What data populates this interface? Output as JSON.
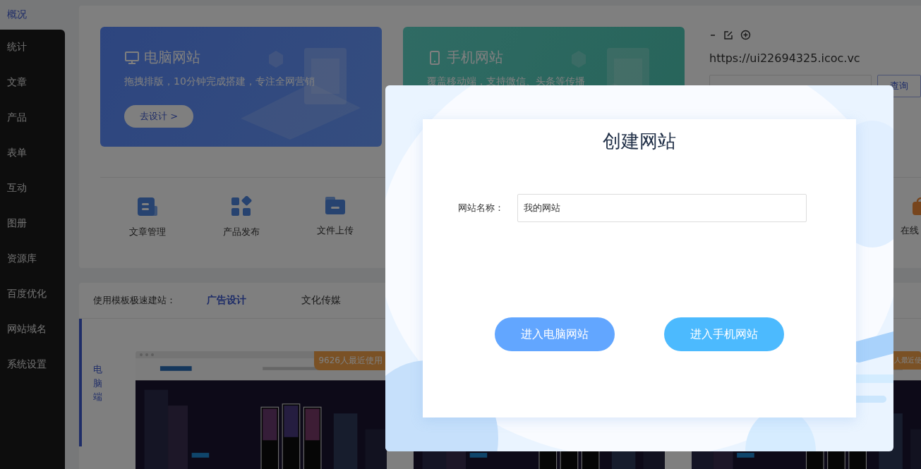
{
  "sidebar": {
    "items": [
      {
        "label": "概况",
        "selected": true
      },
      {
        "label": "统计",
        "selected": false
      },
      {
        "label": "文章",
        "selected": false
      },
      {
        "label": "产品",
        "selected": false
      },
      {
        "label": "表单",
        "selected": false
      },
      {
        "label": "互动",
        "selected": false
      },
      {
        "label": "图册",
        "selected": false
      },
      {
        "label": "资源库",
        "selected": false
      },
      {
        "label": "百度优化",
        "selected": false
      },
      {
        "label": "网站域名",
        "selected": false
      },
      {
        "label": "系统设置",
        "selected": false
      }
    ]
  },
  "site_cards": [
    {
      "kind": "desktop",
      "title": "电脑网站",
      "subtitle": "拖拽排版，10分钟完成搭建，专注全网营销",
      "button": "去设计 >"
    },
    {
      "kind": "mobile",
      "title": "手机网站",
      "subtitle": "覆盖移动端，支持微信、头条等传播"
    }
  ],
  "site_info": {
    "url": "https://ui22694325.icoc.vc",
    "query_button": "查询"
  },
  "quick_actions": [
    {
      "kind": "article",
      "label": "文章管理"
    },
    {
      "kind": "product",
      "label": "产品发布"
    },
    {
      "kind": "file",
      "label": "文件上传"
    },
    {
      "kind": "online",
      "label": "在线"
    }
  ],
  "templates": {
    "label": "使用模板极速建站：",
    "tabs": [
      {
        "label": "广告设计",
        "selected": true
      },
      {
        "label": "文化传媒",
        "selected": false
      }
    ],
    "category": "电脑端",
    "items": [
      {
        "kind": "picture",
        "usage": "9626人最近使用"
      },
      {
        "kind": "picture"
      },
      {
        "kind": "picture",
        "usage": "人最近使"
      }
    ]
  },
  "modal": {
    "title": "创建网站",
    "field_label": "网站名称：",
    "field_value": "我的网站",
    "buttons": [
      {
        "kind": "desktop",
        "label": "进入电脑网站"
      },
      {
        "kind": "mobile",
        "label": "进入手机网站"
      }
    ]
  }
}
